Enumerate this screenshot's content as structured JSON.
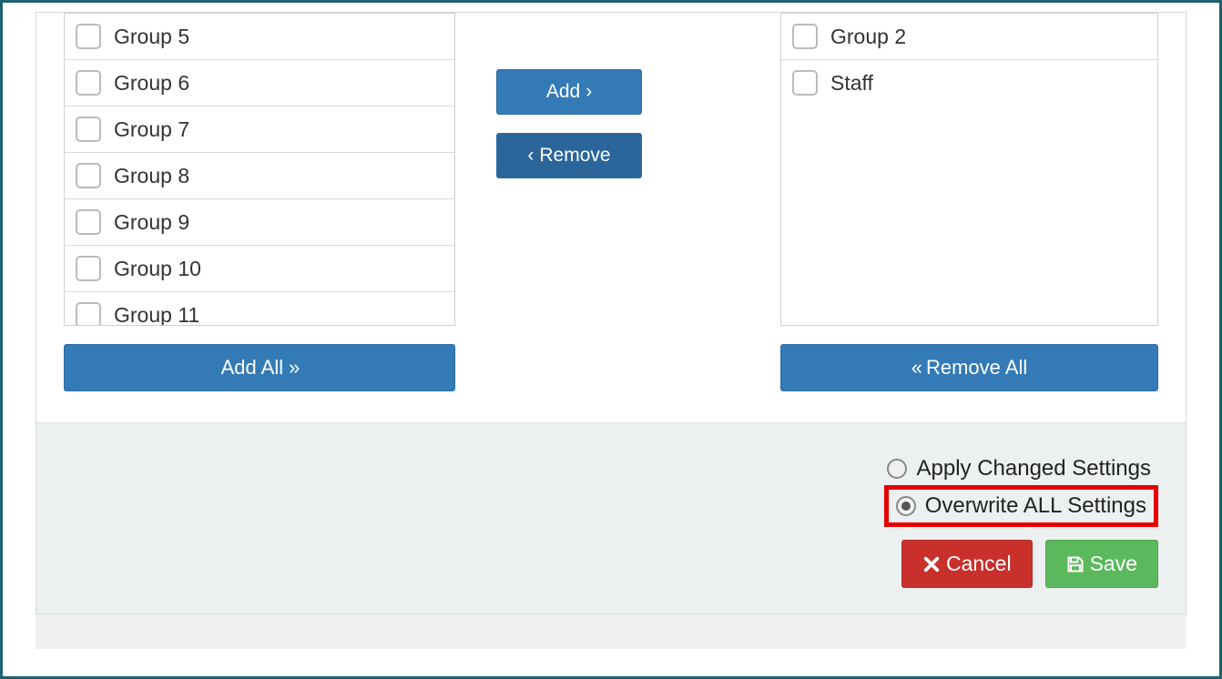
{
  "leftList": {
    "items": [
      {
        "label": "Group 5"
      },
      {
        "label": "Group 6"
      },
      {
        "label": "Group 7"
      },
      {
        "label": "Group 8"
      },
      {
        "label": "Group 9"
      },
      {
        "label": "Group 10"
      },
      {
        "label": "Group 11"
      }
    ]
  },
  "rightList": {
    "items": [
      {
        "label": "Group 2"
      },
      {
        "label": "Staff"
      }
    ]
  },
  "buttons": {
    "add": "Add",
    "remove": "Remove",
    "addAll": "Add All",
    "removeAll": "Remove All",
    "cancel": "Cancel",
    "save": "Save"
  },
  "radios": {
    "applyChanged": "Apply Changed Settings",
    "overwriteAll": "Overwrite ALL Settings",
    "selected": "overwriteAll"
  },
  "highlight": "overwriteAll"
}
